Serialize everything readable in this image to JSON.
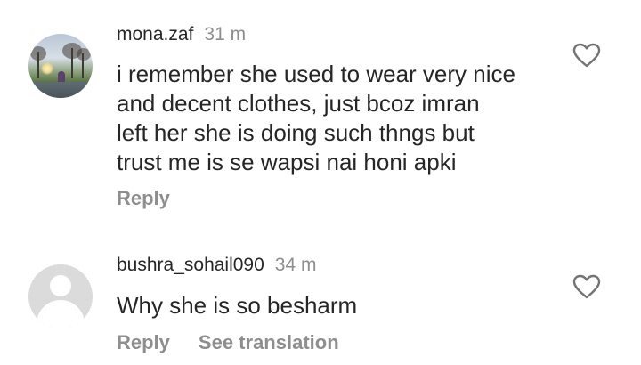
{
  "comments": [
    {
      "username": "mona.zaf",
      "time": "31 m",
      "avatar": "photo-avatar",
      "lines": [
        "i remember she used to wear very nice",
        "and decent clothes, just bcoz imran",
        "left her she is doing such thngs but",
        "trust me  is se wapsi nai honi apki"
      ],
      "reply_label": "Reply",
      "like_icon": "heart-outline-icon"
    },
    {
      "username": "bushra_sohail090",
      "time": "34 m",
      "avatar": "default-avatar",
      "lines": [
        "Why she is so besharm"
      ],
      "reply_label": "Reply",
      "translate_label": "See translation",
      "like_icon": "heart-outline-icon"
    }
  ],
  "colors": {
    "text": "#262626",
    "secondary": "#8e8e8e",
    "default_avatar_bg": "#dbdbdb"
  }
}
